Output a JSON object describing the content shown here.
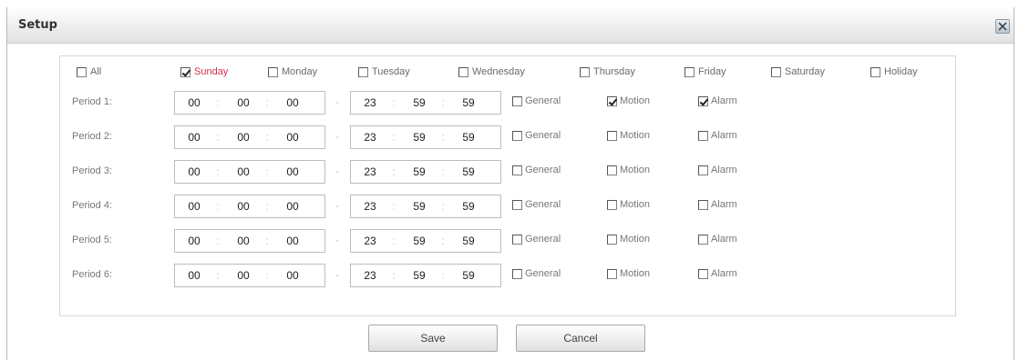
{
  "dialog": {
    "title": "Setup"
  },
  "days": [
    {
      "label": "All",
      "checked": false,
      "active": false
    },
    {
      "label": "Sunday",
      "checked": true,
      "active": true
    },
    {
      "label": "Monday",
      "checked": false,
      "active": false
    },
    {
      "label": "Tuesday",
      "checked": false,
      "active": false
    },
    {
      "label": "Wednesday",
      "checked": false,
      "active": false
    },
    {
      "label": "Thursday",
      "checked": false,
      "active": false
    },
    {
      "label": "Friday",
      "checked": false,
      "active": false
    },
    {
      "label": "Saturday",
      "checked": false,
      "active": false
    },
    {
      "label": "Holiday",
      "checked": false,
      "active": false
    }
  ],
  "periods": [
    {
      "label": "Period 1:",
      "start": [
        "00",
        "00",
        "00"
      ],
      "end": [
        "23",
        "59",
        "59"
      ],
      "general": false,
      "motion": true,
      "alarm": true
    },
    {
      "label": "Period 2:",
      "start": [
        "00",
        "00",
        "00"
      ],
      "end": [
        "23",
        "59",
        "59"
      ],
      "general": false,
      "motion": false,
      "alarm": false
    },
    {
      "label": "Period 3:",
      "start": [
        "00",
        "00",
        "00"
      ],
      "end": [
        "23",
        "59",
        "59"
      ],
      "general": false,
      "motion": false,
      "alarm": false
    },
    {
      "label": "Period 4:",
      "start": [
        "00",
        "00",
        "00"
      ],
      "end": [
        "23",
        "59",
        "59"
      ],
      "general": false,
      "motion": false,
      "alarm": false
    },
    {
      "label": "Period 5:",
      "start": [
        "00",
        "00",
        "00"
      ],
      "end": [
        "23",
        "59",
        "59"
      ],
      "general": false,
      "motion": false,
      "alarm": false
    },
    {
      "label": "Period 6:",
      "start": [
        "00",
        "00",
        "00"
      ],
      "end": [
        "23",
        "59",
        "59"
      ],
      "general": false,
      "motion": false,
      "alarm": false
    }
  ],
  "options": {
    "general": "General",
    "motion": "Motion",
    "alarm": "Alarm"
  },
  "range_separator": "-",
  "time_separator": ":",
  "buttons": {
    "save": "Save",
    "cancel": "Cancel"
  },
  "colors": {
    "active_day": "#d32f4e"
  }
}
